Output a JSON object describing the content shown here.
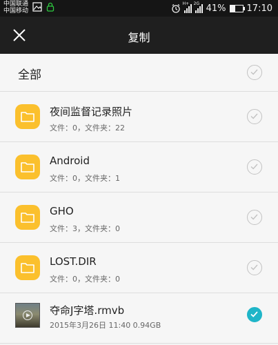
{
  "status_bar": {
    "carrier_1": "中国联通",
    "carrier_2": "中国移动",
    "network_tag_1": "H+",
    "network_tag_2": "2G",
    "battery_level": "41%",
    "time": "17:10"
  },
  "title_bar": {
    "title": "复制"
  },
  "select_all": {
    "label": "全部"
  },
  "items": [
    {
      "type": "folder",
      "name": "夜间监督记录照片",
      "meta": "文件：0，文件夹：22",
      "checked": false
    },
    {
      "type": "folder",
      "name": "Android",
      "meta": "文件：0，文件夹：1",
      "checked": false
    },
    {
      "type": "folder",
      "name": "GHO",
      "meta": "文件：3，文件夹：0",
      "checked": false
    },
    {
      "type": "folder",
      "name": "LOST.DIR",
      "meta": "文件：0，文件夹：0",
      "checked": false
    },
    {
      "type": "video",
      "name": "夺命J字塔.rmvb",
      "meta": "2015年3月26日 11:40 0.94GB",
      "checked": true
    }
  ],
  "colors": {
    "folder": "#fbc02d",
    "check_active": "#1fb5c8",
    "title_bar": "#1f1f1f"
  }
}
